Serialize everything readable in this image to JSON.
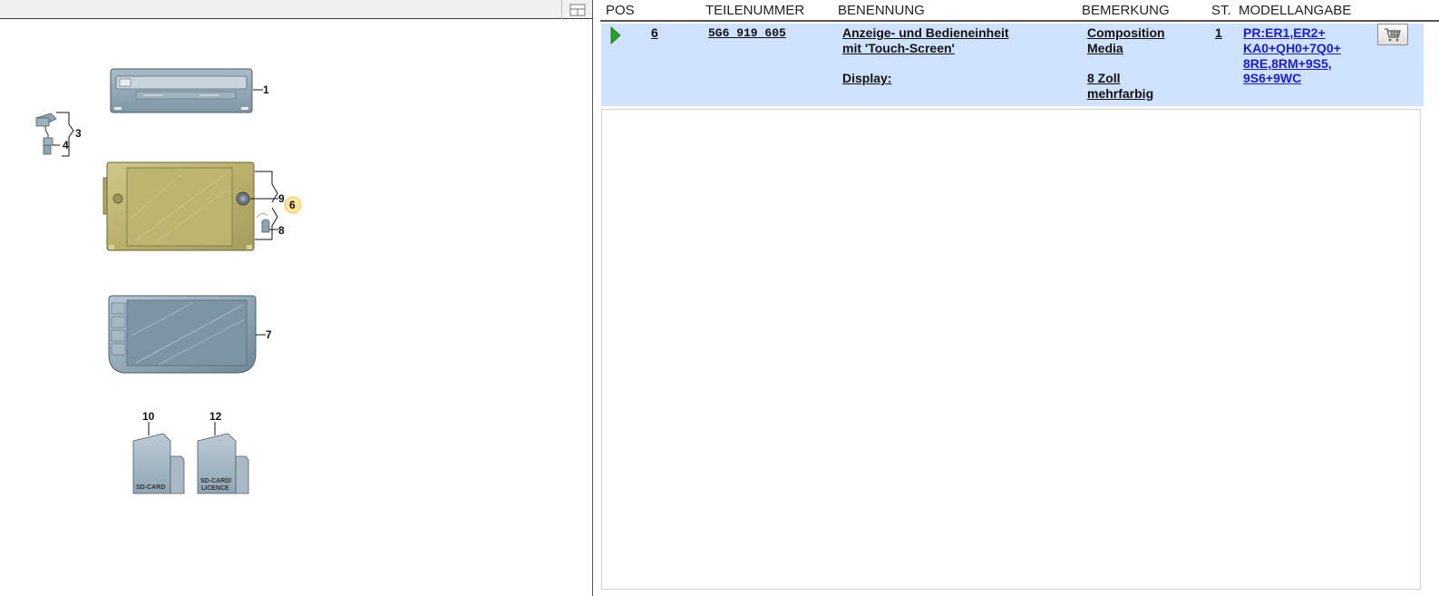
{
  "diagram": {
    "callouts": {
      "c1": "1",
      "c3": "3",
      "c4": "4",
      "c9": "9",
      "c6": "6",
      "c8": "8",
      "c7": "7",
      "c10": "10",
      "c12": "12"
    },
    "card_labels": {
      "sd_card": "SD-CARD",
      "sd_card_licence_1": "SD-CARD/",
      "sd_card_licence_2": "LICENCE"
    }
  },
  "table": {
    "headers": {
      "pos": "POS",
      "teilenummer": "TEILENUMMER",
      "benennung": "BENENNUNG",
      "bemerkung": "BEMERKUNG",
      "st": "ST.",
      "modellangabe": "MODELLANGABE"
    },
    "rows": [
      {
        "pos": "6",
        "teilenummer": "5G6 919 605",
        "benennung_1": "Anzeige- und Bedieneinheit",
        "benennung_2": "mit 'Touch-Screen'",
        "benennung_3": "Display:",
        "bemerkung_1": "Composition",
        "bemerkung_2": "Media",
        "bemerkung_3": "8 Zoll",
        "bemerkung_4": "mehrfarbig",
        "st": "1",
        "modell_1": "PR:ER1,ER2+",
        "modell_2": "KA0+QH0+7Q0+",
        "modell_3": "8RE,8RM+9S5,",
        "modell_4": "9S6+9WC"
      }
    ]
  },
  "colors": {
    "row_highlight": "#cfe2ff",
    "model_link": "#1a1ad8",
    "selected_callout": "#ffe79a",
    "play_icon": "#1fa51f"
  }
}
